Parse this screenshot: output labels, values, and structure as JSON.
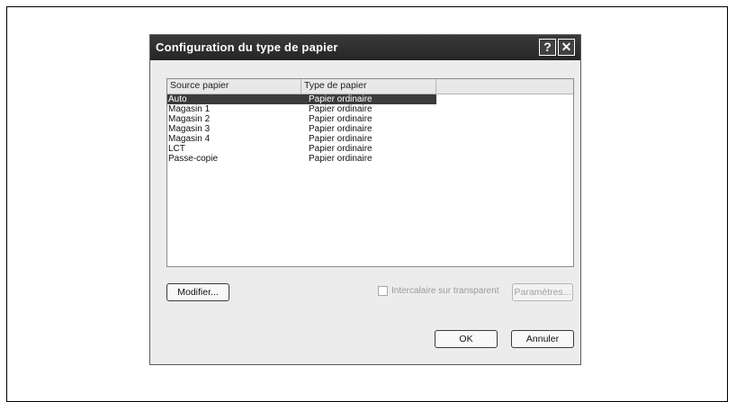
{
  "dialog": {
    "title": "Configuration du type de papier",
    "help_glyph": "?",
    "close_glyph": "✕"
  },
  "table": {
    "columns": [
      "Source papier",
      "Type de papier"
    ],
    "rows": [
      {
        "source": "Auto",
        "type": "Papier ordinaire",
        "selected": true
      },
      {
        "source": "Magasin 1",
        "type": "Papier ordinaire"
      },
      {
        "source": "Magasin 2",
        "type": "Papier ordinaire"
      },
      {
        "source": "Magasin 3",
        "type": "Papier ordinaire"
      },
      {
        "source": "Magasin 4",
        "type": "Papier ordinaire"
      },
      {
        "source": "LCT",
        "type": "Papier ordinaire"
      },
      {
        "source": "Passe-copie",
        "type": "Papier ordinaire"
      }
    ]
  },
  "controls": {
    "modify_label": "Modifier...",
    "interleave_label": "Intercalaire sur transparent",
    "interleave_checked": false,
    "params_label": "Paramètres...",
    "ok_label": "OK",
    "cancel_label": "Annuler"
  },
  "colors": {
    "titlebar": "#2f2f2f",
    "selection": "#3b3b3b",
    "dialog_bg": "#ececec"
  }
}
